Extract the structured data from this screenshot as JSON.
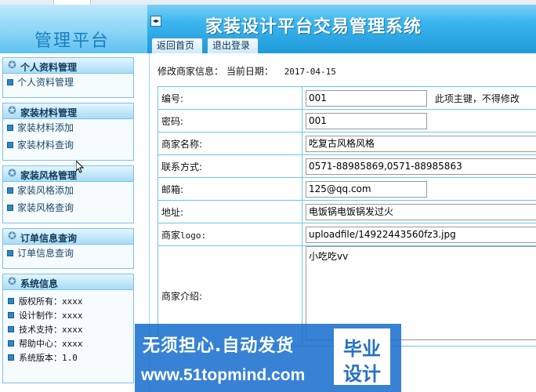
{
  "header": {
    "brand_title": "管理平台",
    "collapse_glyph": "◂▸",
    "system_title": "家装设计平台交易管理系统",
    "tabs": [
      {
        "label": "返回首页"
      },
      {
        "label": "退出登录"
      }
    ]
  },
  "sidebar": {
    "sections": [
      {
        "title": "个人资料管理",
        "items": [
          "个人资料管理"
        ]
      },
      {
        "title": "家装材料管理",
        "items": [
          "家装材料添加",
          "家装材料查询"
        ]
      },
      {
        "title": "家装风格管理",
        "items": [
          "家装风格添加",
          "家装风格查询"
        ]
      },
      {
        "title": "订单信息查询",
        "items": [
          "订单信息查询"
        ]
      }
    ],
    "system_info": {
      "title": "系统信息",
      "items": [
        "版权所有：xxxx",
        "设计制作：xxxx",
        "技术支持：xxxx",
        "帮助中心：xxxx",
        "系统版本：1.0"
      ]
    }
  },
  "main": {
    "page_label": "修改商家信息：",
    "date_label": "当前日期：",
    "date_value": "2017-04-15",
    "fields": {
      "id": {
        "label": "编号:",
        "value": "001",
        "note": "此项主键，不得修改"
      },
      "password": {
        "label": "密码:",
        "value": "001"
      },
      "shop_name": {
        "label": "商家名称:",
        "value": "吃复古风格风格"
      },
      "contact": {
        "label": "联系方式:",
        "value": "0571-88985869,0571-88985863"
      },
      "email": {
        "label": "邮箱:",
        "value": "125@qq.com"
      },
      "address": {
        "label": "地址:",
        "value": "电饭锅电饭锅发过火"
      },
      "logo": {
        "label_cn": "商家",
        "label_en": "logo:",
        "value": "uploadfile/14922443560fz3.jpg"
      },
      "description": {
        "label": "商家介绍:",
        "value": "小吃吃vv"
      }
    }
  },
  "watermark": {
    "line1": "无须担心.自动发货",
    "line2": "www.51topmind.com",
    "badge_line1": "毕业",
    "badge_line2": "设计"
  },
  "colors": {
    "header_blue": "#1e9ad9",
    "table_border": "#6cc7e6",
    "sidebar_border": "#79c3e8",
    "watermark_blue": "#166ecd"
  }
}
